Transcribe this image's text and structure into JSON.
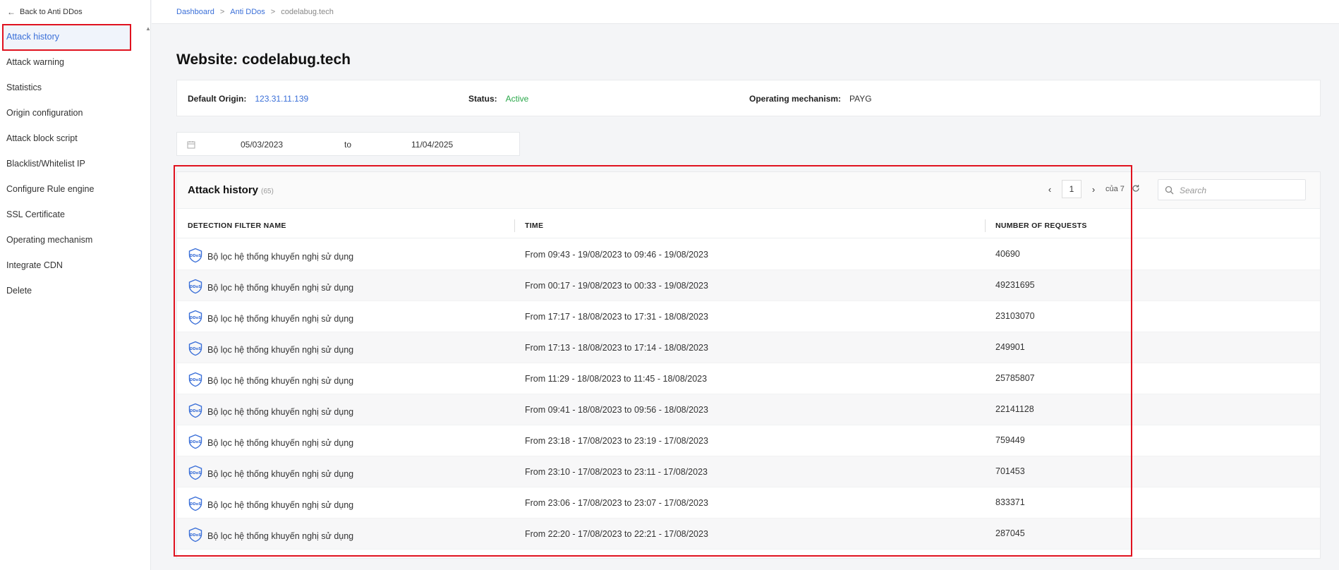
{
  "sidebar": {
    "back_label": "Back to Anti DDos",
    "items": [
      {
        "label": "Attack history"
      },
      {
        "label": "Attack warning"
      },
      {
        "label": "Statistics"
      },
      {
        "label": "Origin configuration"
      },
      {
        "label": "Attack block script"
      },
      {
        "label": "Blacklist/Whitelist IP"
      },
      {
        "label": "Configure Rule engine"
      },
      {
        "label": "SSL Certificate"
      },
      {
        "label": "Operating mechanism"
      },
      {
        "label": "Integrate CDN"
      },
      {
        "label": "Delete"
      }
    ]
  },
  "breadcrumb": {
    "items": [
      "Dashboard",
      "Anti DDos"
    ],
    "separator": ">",
    "current": "codelabug.tech"
  },
  "page": {
    "title": "Website: codelabug.tech"
  },
  "info": {
    "origin_label": "Default Origin:",
    "origin_value": "123.31.11.139",
    "status_label": "Status:",
    "status_value": "Active",
    "mechanism_label": "Operating mechanism:",
    "mechanism_value": "PAYG"
  },
  "date_range": {
    "from": "05/03/2023",
    "to_label": "to",
    "to": "11/04/2025"
  },
  "table": {
    "title": "Attack history",
    "count": "(65)",
    "pager": {
      "prev": "‹",
      "page": "1",
      "next": "›",
      "of_text": "của 7"
    },
    "search_placeholder": "Search",
    "columns": [
      "DETECTION FILTER NAME",
      "TIME",
      "NUMBER OF REQUESTS"
    ],
    "rows": [
      {
        "name": "Bộ lọc hệ thống khuyến nghị sử dụng",
        "time": "From 09:43 - 19/08/2023 to 09:46 - 19/08/2023",
        "requests": "40690"
      },
      {
        "name": "Bộ lọc hệ thống khuyến nghị sử dụng",
        "time": "From 00:17 - 19/08/2023 to 00:33 - 19/08/2023",
        "requests": "49231695"
      },
      {
        "name": "Bộ lọc hệ thống khuyến nghị sử dụng",
        "time": "From 17:17 - 18/08/2023 to 17:31 - 18/08/2023",
        "requests": "23103070"
      },
      {
        "name": "Bộ lọc hệ thống khuyến nghị sử dụng",
        "time": "From 17:13 - 18/08/2023 to 17:14 - 18/08/2023",
        "requests": "249901"
      },
      {
        "name": "Bộ lọc hệ thống khuyến nghị sử dụng",
        "time": "From 11:29 - 18/08/2023 to 11:45 - 18/08/2023",
        "requests": "25785807"
      },
      {
        "name": "Bộ lọc hệ thống khuyến nghị sử dụng",
        "time": "From 09:41 - 18/08/2023 to 09:56 - 18/08/2023",
        "requests": "22141128"
      },
      {
        "name": "Bộ lọc hệ thống khuyến nghị sử dụng",
        "time": "From 23:18 - 17/08/2023 to 23:19 - 17/08/2023",
        "requests": "759449"
      },
      {
        "name": "Bộ lọc hệ thống khuyến nghị sử dụng",
        "time": "From 23:10 - 17/08/2023 to 23:11 - 17/08/2023",
        "requests": "701453"
      },
      {
        "name": "Bộ lọc hệ thống khuyến nghị sử dụng",
        "time": "From 23:06 - 17/08/2023 to 23:07 - 17/08/2023",
        "requests": "833371"
      },
      {
        "name": "Bộ lọc hệ thống khuyến nghị sử dụng",
        "time": "From 22:20 - 17/08/2023 to 22:21 - 17/08/2023",
        "requests": "287045"
      }
    ]
  },
  "icons": {
    "back": "arrow-left-icon",
    "calendar": "calendar-icon",
    "search": "search-icon",
    "refresh": "refresh-icon",
    "row": "ddos-shield-icon"
  },
  "colors": {
    "accent": "#3a6fd8",
    "active": "#2aa84a",
    "highlight": "#e0121f"
  }
}
